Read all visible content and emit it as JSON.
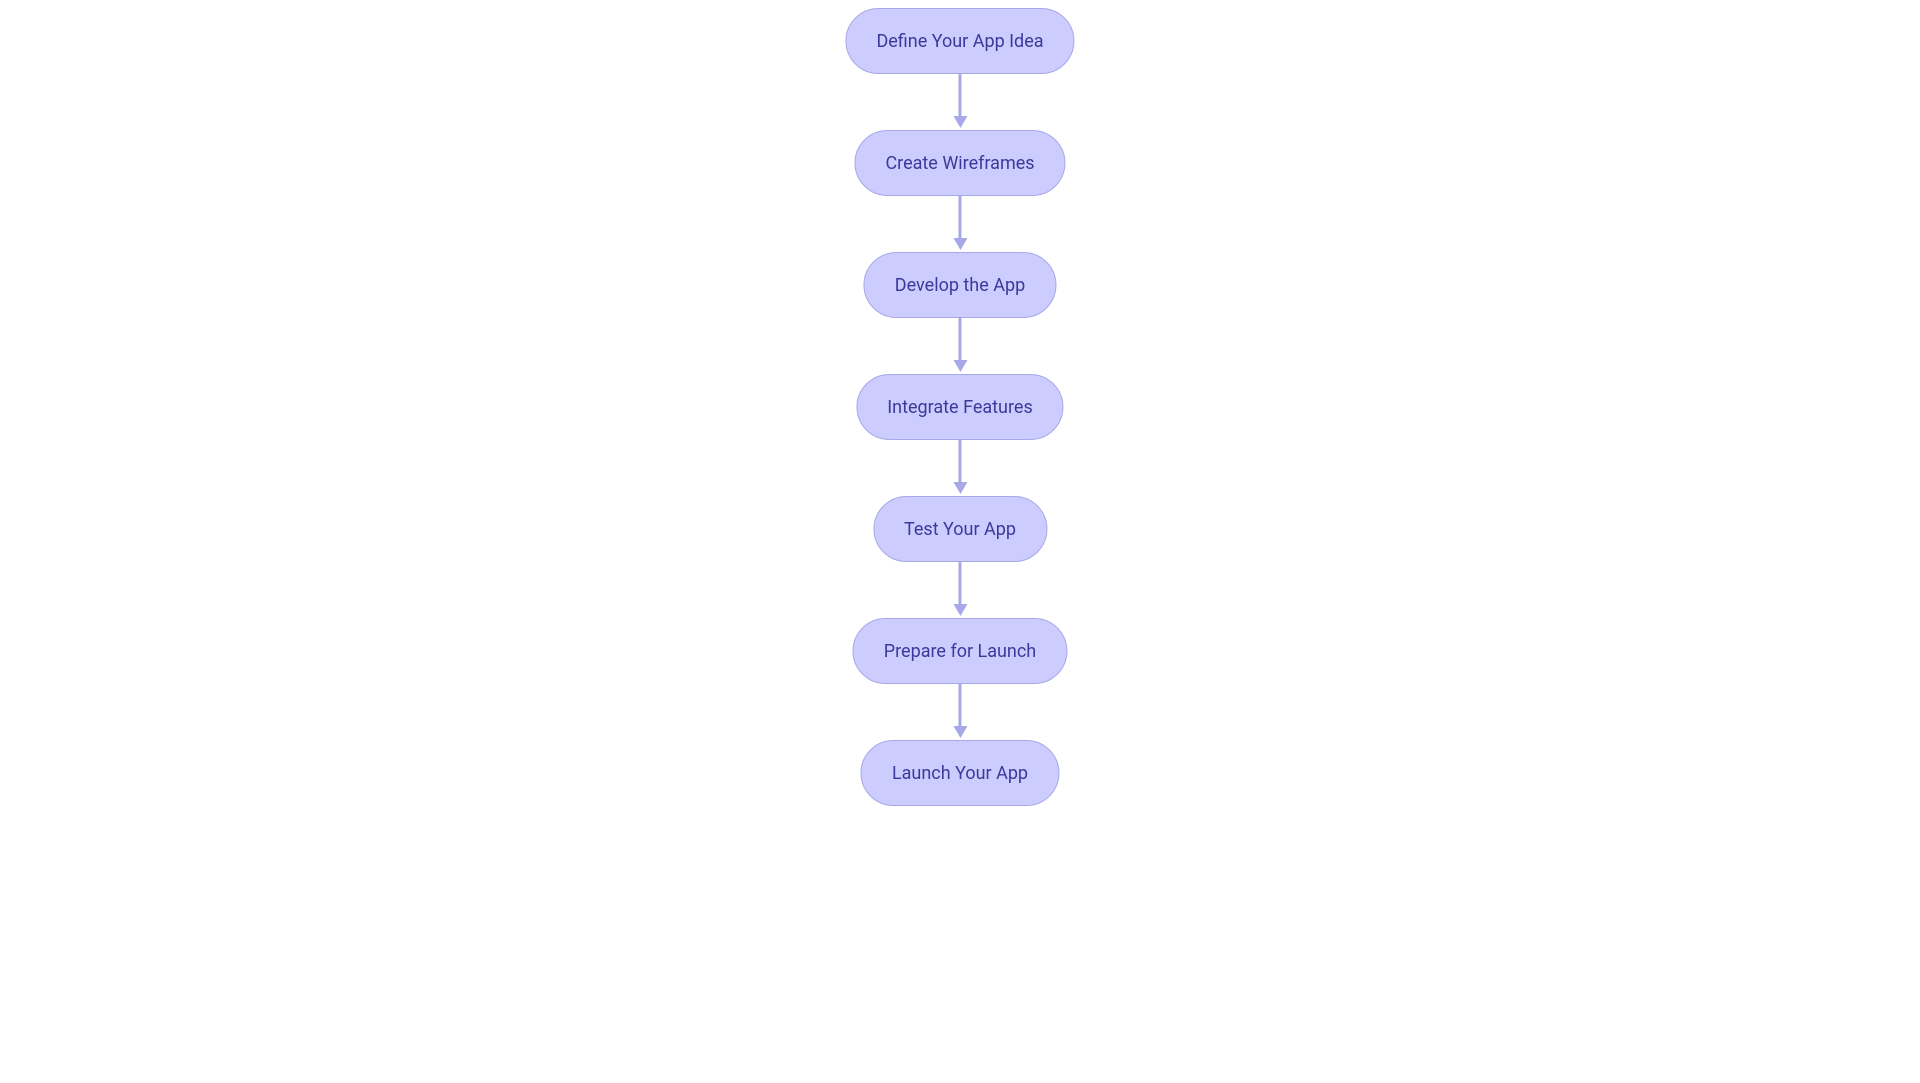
{
  "flowchart": {
    "nodes": [
      {
        "label": "Define Your App Idea"
      },
      {
        "label": "Create Wireframes"
      },
      {
        "label": "Develop the App"
      },
      {
        "label": "Integrate Features"
      },
      {
        "label": "Test Your App"
      },
      {
        "label": "Prepare for Launch"
      },
      {
        "label": "Launch Your App"
      }
    ],
    "colors": {
      "node_fill": "#ccccff",
      "node_border": "#a7a8e8",
      "node_text": "#3b3a9a",
      "arrow": "#a7a8e8"
    }
  }
}
